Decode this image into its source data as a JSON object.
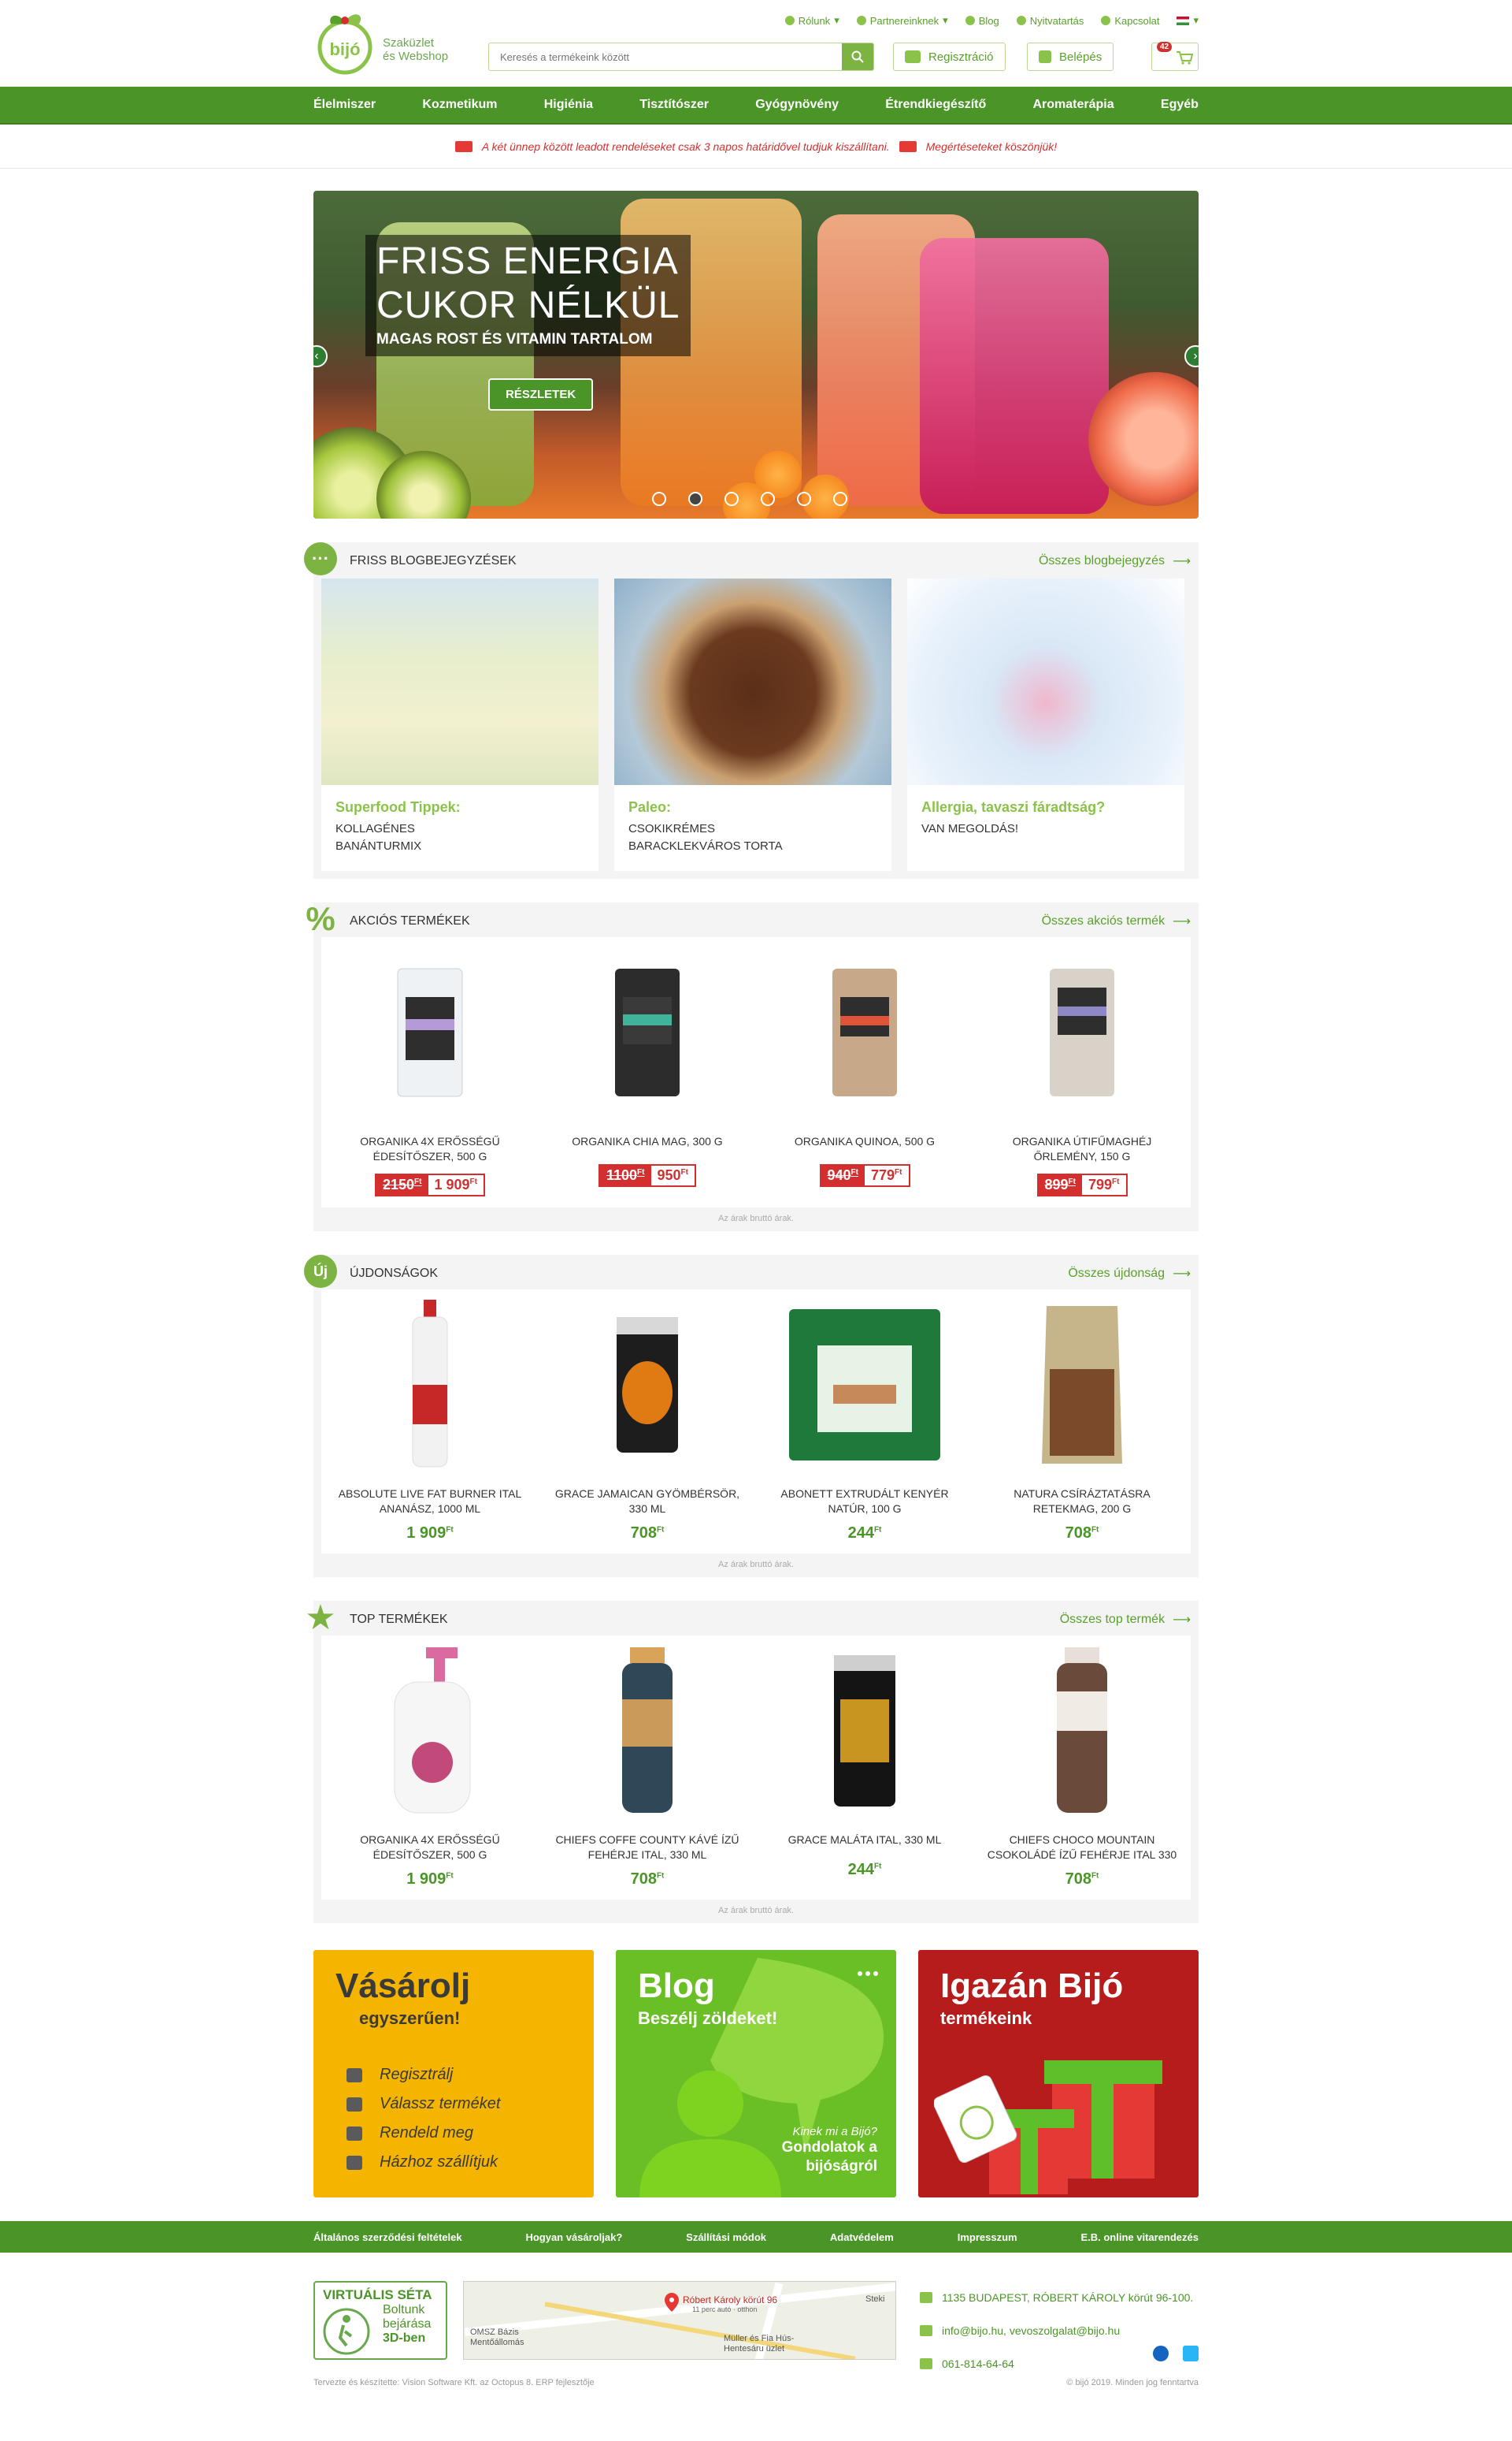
{
  "header": {
    "logo_text": "bijó",
    "tagline1": "Szaküzlet",
    "tagline2": "és Webshop",
    "topnav": [
      "Rólunk",
      "Partnereinknek",
      "Blog",
      "Nyitvatartás",
      "Kapcsolat"
    ],
    "search_placeholder": "Keresés a termékeink között",
    "register": "Regisztráció",
    "login": "Belépés",
    "cart_count": "42"
  },
  "mainnav": [
    "Élelmiszer",
    "Kozmetikum",
    "Higiénia",
    "Tisztítószer",
    "Gyógynövény",
    "Étrendkiegészítő",
    "Aromaterápia",
    "Egyéb"
  ],
  "notice": {
    "text1": "A két ünnep között leadott rendeléseket csak 3 napos határidővel tudjuk kiszállítani.",
    "text2": "Megértéseteket köszönjük!"
  },
  "hero": {
    "line1": "FRISS ENERGIA",
    "line2": "CUKOR NÉLKÜL",
    "line3": "MAGAS ROST ÉS VITAMIN TARTALOM",
    "button": "RÉSZLETEK",
    "active_slide": 1,
    "slides": 6
  },
  "blog": {
    "title": "FRISS BLOGBEJEGYZÉSEK",
    "link": "Összes blogbejegyzés",
    "posts": [
      {
        "title": "Superfood Tippek:",
        "sub": "KOLLAGÉNES\nBANÁNTURMIX"
      },
      {
        "title": "Paleo:",
        "sub": "CSOKIKRÉMES\nBARACKLEKVÁROS TORTA"
      },
      {
        "title": "Allergia, tavaszi fáradtság?",
        "sub": "VAN MEGOLDÁS!"
      }
    ]
  },
  "sale": {
    "title": "AKCIÓS TERMÉKEK",
    "link": "Összes akciós termék",
    "icon": "%",
    "items": [
      {
        "name": "ORGANIKA 4X ERŐSSÉGŰ ÉDESÍTŐSZER, 500 G",
        "old": "2150",
        "new": "1 909"
      },
      {
        "name": "ORGANIKA CHIA MAG, 300 G",
        "old": "1100",
        "new": "950"
      },
      {
        "name": "ORGANIKA QUINOA, 500 G",
        "old": "940",
        "new": "779"
      },
      {
        "name": "ORGANIKA ÚTIFŰMAGHÉJ ŐRLEMÉNY, 150 G",
        "old": "899",
        "new": "799"
      }
    ]
  },
  "new": {
    "title": "ÚJDONSÁGOK",
    "link": "Összes újdonság",
    "icon": "Új",
    "items": [
      {
        "name": "ABSOLUTE LIVE FAT BURNER ITAL ANANÁSZ, 1000 ML",
        "price": "1 909"
      },
      {
        "name": "GRACE JAMAICAN GYÖMBÉRSÖR, 330 ML",
        "price": "708"
      },
      {
        "name": "ABONETT EXTRUDÁLT KENYÉR NATÚR, 100 G",
        "price": "244"
      },
      {
        "name": "NATURA CSÍRÁZTATÁSRA RETEKMAG, 200 G",
        "price": "708"
      }
    ]
  },
  "top": {
    "title": "TOP TERMÉKEK",
    "link": "Összes top termék",
    "icon": "★",
    "items": [
      {
        "name": "ORGANIKA 4X ERŐSSÉGŰ ÉDESÍTŐSZER, 500 G",
        "price": "1 909"
      },
      {
        "name": "CHIEFS COFFE COUNTY KÁVÉ ÍZŰ FEHÉRJE ITAL, 330 ML",
        "price": "708"
      },
      {
        "name": "GRACE MALÁTA ITAL, 330 ML",
        "price": "244"
      },
      {
        "name": "CHIEFS CHOCO MOUNTAIN CSOKOLÁDÉ ÍZŰ FEHÉRJE ITAL 330",
        "price": "708"
      }
    ]
  },
  "currency": "Ft",
  "vat_note": "Az árak bruttó árak.",
  "promo": {
    "shop_title": "Vásárolj",
    "shop_sub": "egyszerűen!",
    "shop_steps": [
      "Regisztrálj",
      "Válassz terméket",
      "Rendeld meg",
      "Házhoz szállítjuk"
    ],
    "blog_title": "Blog",
    "blog_sub": "Beszélj zöldeket!",
    "blog_q": "Kinek mi a Bijó?",
    "blog_q_bold": "Bijó",
    "blog_ans": "Gondolatok a bijóságról",
    "bijo_title": "Igazán Bijó",
    "bijo_sub": "termékeink"
  },
  "footer_nav": [
    "Általános szerződési feltételek",
    "Hogyan vásároljak?",
    "Szállítási módok",
    "Adatvédelem",
    "Impresszum",
    "E.B. online vitarendezés"
  ],
  "virtual": {
    "a": "VIRTUÁLIS SÉTA",
    "b1": "Boltunk",
    "b2": "bejárása",
    "b3": "3D-ben"
  },
  "map_labels": {
    "pin": "Róbert Károly körút 96",
    "pin_sub": "11 perc autó · otthon",
    "place1": "OMSZ Bázis Mentőállomás",
    "place2": "Müller és Fia Hús-Hentesáru üzlet",
    "steki": "Steki"
  },
  "contact": {
    "address": "1135 BUDAPEST, RÓBERT KÁROLY körút 96-100.",
    "email": "info@bijo.hu, vevoszolgalat@bijo.hu",
    "phone": "061-814-64-64"
  },
  "bottom": {
    "left": "Tervezte és készítette: Vision Software Kft. az Octopus 8. ERP fejlesztője",
    "right": "© bijó 2019. Minden jog fenntartva"
  },
  "colors": {
    "brand_green": "#4b9528",
    "accent_green": "#8bc34a",
    "sale_red": "#d32f2f",
    "promo_yellow": "#f4b400",
    "promo_red": "#b71c1c"
  }
}
